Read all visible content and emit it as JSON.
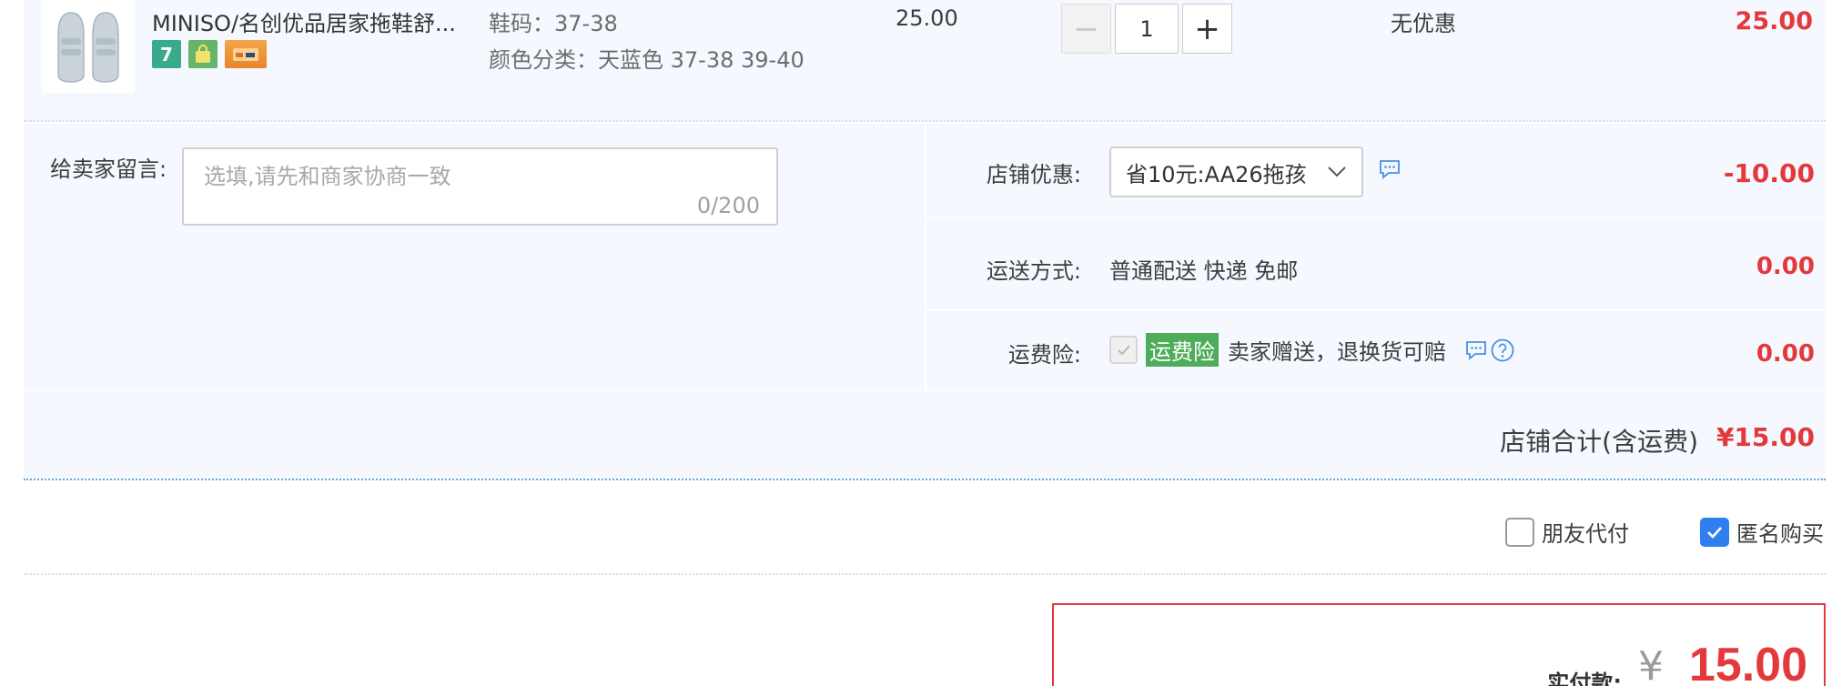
{
  "item": {
    "title": "MINISO/名创优品居家拖鞋舒...",
    "spec_size": "鞋码：37-38",
    "spec_color": "颜色分类：天蓝色 37-38 39-40",
    "unit_price": "25.00",
    "quantity": "1",
    "minus_label": "−",
    "plus_label": "+",
    "discount": "无优惠",
    "subtotal": "25.00",
    "badge_seven": "7"
  },
  "message": {
    "label": "给卖家留言:",
    "placeholder": "选填,请先和商家协商一致",
    "counter": "0/200"
  },
  "shop_discount": {
    "label": "店铺优惠:",
    "selected": "省10元:AA26拖孩",
    "amount": "-10.00"
  },
  "shipping": {
    "label": "运送方式:",
    "value": "普通配送 快递 免邮",
    "amount": "0.00"
  },
  "insurance": {
    "label": "运费险:",
    "tag": "运费险",
    "text": "卖家赠送，退换货可赔",
    "amount": "0.00"
  },
  "shop_total": {
    "label": "店铺合计(含运费)",
    "amount": "¥15.00"
  },
  "options": {
    "friend_pay": "朋友代付",
    "anonymous": "匿名购买"
  },
  "payment": {
    "label": "实付款:",
    "currency": "¥",
    "amount": "15.00"
  },
  "colors": {
    "accent_red": "#e4393c",
    "panel_bg": "#f5f9ff",
    "checkbox_blue": "#2f7ff0",
    "insurance_green": "#4eac5b"
  },
  "icons": {
    "thumb": "slipper-product-image",
    "chat": "chat-bubble-icon",
    "help": "question-circle-icon",
    "chevron": "chevron-down-icon",
    "check": "checkmark-icon"
  }
}
